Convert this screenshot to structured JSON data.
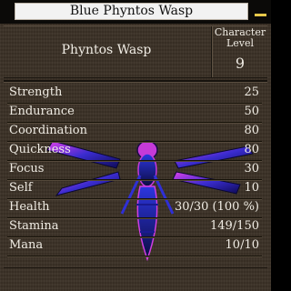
{
  "window": {
    "title": "Blue Phyntos Wasp"
  },
  "header": {
    "name": "Phyntos Wasp",
    "level_label_line1": "Character",
    "level_label_line2": "Level",
    "level_value": "9"
  },
  "stats": [
    {
      "name": "Strength",
      "value": "25"
    },
    {
      "name": "Endurance",
      "value": "50"
    },
    {
      "name": "Coordination",
      "value": "80"
    },
    {
      "name": "Quickness",
      "value": "80"
    },
    {
      "name": "Focus",
      "value": "30"
    },
    {
      "name": "Self",
      "value": "10"
    },
    {
      "name": "Health",
      "value": "30/30 (100 %)"
    },
    {
      "name": "Stamina",
      "value": "149/150"
    },
    {
      "name": "Mana",
      "value": "10/10"
    }
  ],
  "colors": {
    "panel_bg": "#3c3227",
    "text": "#f0ece4",
    "close_accent": "#e8c84a",
    "wasp_blue": "#2a2fd0",
    "wasp_magenta": "#d93ae0"
  },
  "icons": {
    "close": "minimize-bar-icon",
    "portrait": "wasp-creature-icon"
  }
}
